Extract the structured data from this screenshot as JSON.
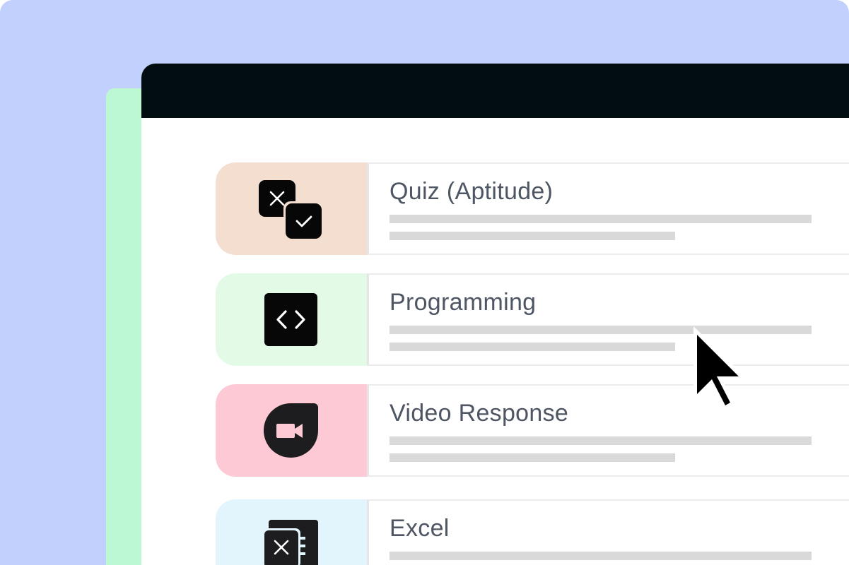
{
  "cards": [
    {
      "title": "Quiz (Aptitude)",
      "icon": "quiz-icon",
      "color": "#f4ded0"
    },
    {
      "title": "Programming",
      "icon": "code-icon",
      "color": "#e3fbe6"
    },
    {
      "title": "Video Response",
      "icon": "video-camera-icon",
      "color": "#fcc9d4"
    },
    {
      "title": "Excel",
      "icon": "excel-icon",
      "color": "#e2f4fc"
    }
  ],
  "colors": {
    "background": "#c1d0fd",
    "accent_panel": "#bdf8d5",
    "titlebar": "#020d12",
    "title_text": "#4e5563",
    "placeholder_bar": "#d9d9d9"
  }
}
